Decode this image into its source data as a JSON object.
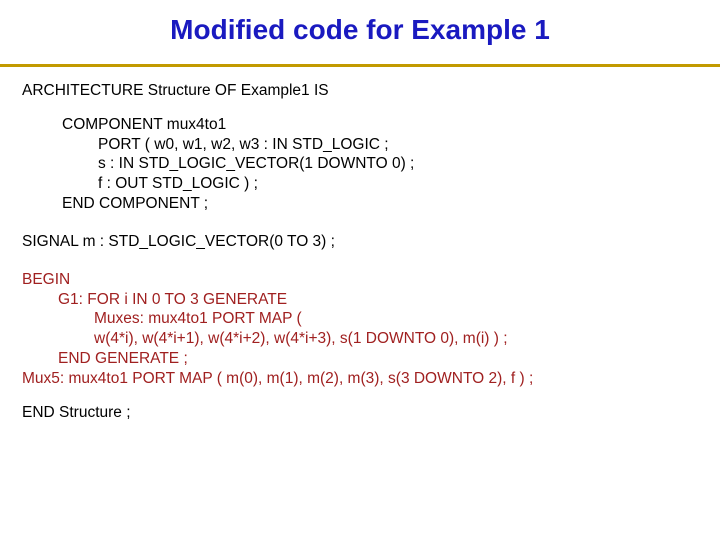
{
  "title": "Modified code for Example 1",
  "arch": "ARCHITECTURE Structure OF Example1 IS",
  "component": {
    "decl": "COMPONENT mux4to1",
    "port1": "PORT ( w0, w1, w2, w3 : IN STD_LOGIC ;",
    "port2": "s : IN STD_LOGIC_VECTOR(1 DOWNTO 0) ;",
    "port3": "f : OUT STD_LOGIC ) ;",
    "end": "END COMPONENT ;"
  },
  "signal": "SIGNAL m : STD_LOGIC_VECTOR(0 TO 3) ;",
  "begin_block": {
    "begin": "BEGIN",
    "g1": "G1: FOR i IN 0 TO 3 GENERATE",
    "muxes": "Muxes: mux4to1 PORT MAP (",
    "map": "w(4*i), w(4*i+1), w(4*i+2), w(4*i+3), s(1 DOWNTO 0), m(i) ) ;",
    "endgen": "END GENERATE ;",
    "mux5": "Mux5: mux4to1 PORT MAP ( m(0), m(1), m(2), m(3), s(3 DOWNTO 2), f ) ;"
  },
  "endstruct": "END Structure ;"
}
